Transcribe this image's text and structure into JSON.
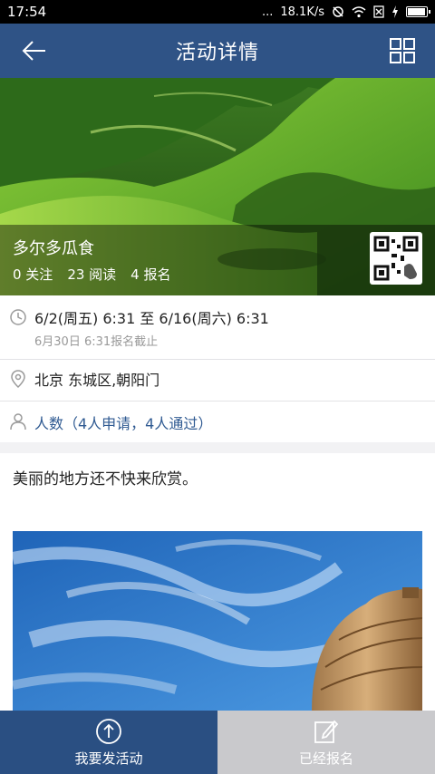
{
  "status_bar": {
    "time": "17:54",
    "dots": "...",
    "network_speed": "18.1K/s"
  },
  "header": {
    "title": "活动详情"
  },
  "event": {
    "title": "多尔多瓜食",
    "follows": "0 关注",
    "reads": "23 阅读",
    "signups": "4 报名"
  },
  "details": {
    "date_range": "6/2(周五) 6:31 至 6/16(周六) 6:31",
    "deadline": "6月30日 6:31报名截止",
    "location": "北京 东城区,朝阳门",
    "people": "人数（4人申请，4人通过）"
  },
  "description": {
    "text": "美丽的地方还不快来欣赏。"
  },
  "bottom_bar": {
    "publish_label": "我要发活动",
    "registered_label": "已经报名"
  },
  "colors": {
    "header": "#2f5386",
    "primary_button": "#2a4f82",
    "secondary_button": "#c9c9cc",
    "accent_text": "#2f5a92"
  }
}
